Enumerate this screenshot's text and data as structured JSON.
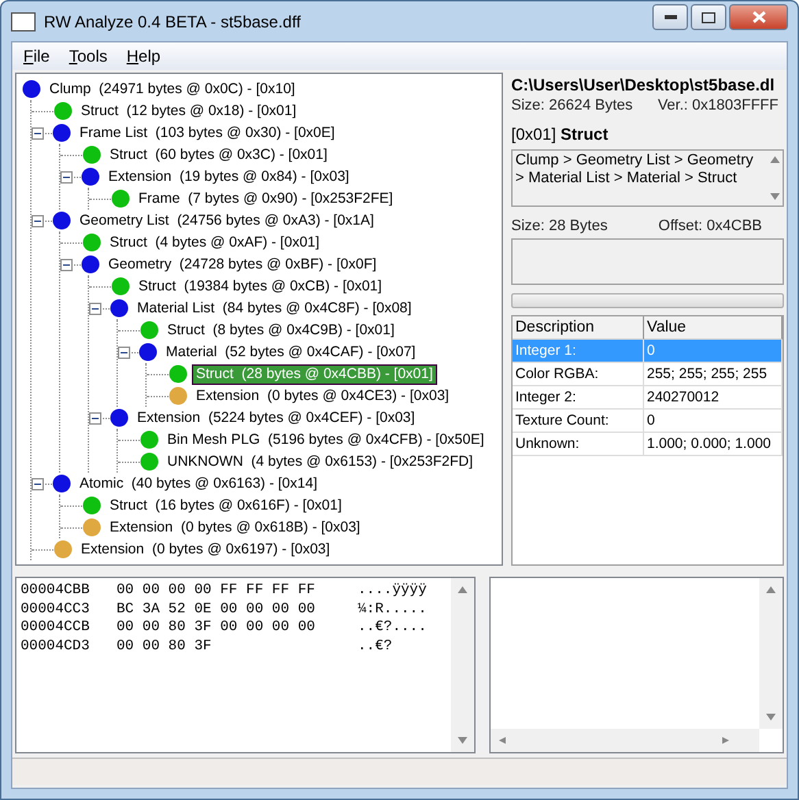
{
  "window": {
    "title": "RW Analyze 0.4 BETA - st5base.dff"
  },
  "menu": [
    {
      "label": "File"
    },
    {
      "label": "Tools"
    },
    {
      "label": "Help"
    }
  ],
  "tree": [
    {
      "label": "Clump  (24971 bytes @ 0x0C) - [0x10]",
      "color": "#1010e0",
      "selected": false,
      "children": [
        {
          "label": "Struct  (12 bytes @ 0x18) - [0x01]",
          "color": "#10c010",
          "selected": false
        },
        {
          "label": "Frame List  (103 bytes @ 0x30) - [0x0E]",
          "color": "#1010e0",
          "selected": false,
          "expanded": true,
          "children": [
            {
              "label": "Struct  (60 bytes @ 0x3C) - [0x01]",
              "color": "#10c010",
              "selected": false
            },
            {
              "label": "Extension  (19 bytes @ 0x84) - [0x03]",
              "color": "#1010e0",
              "selected": false,
              "expanded": true,
              "children": [
                {
                  "label": "Frame  (7 bytes @ 0x90) - [0x253F2FE]",
                  "color": "#10c010",
                  "selected": false
                }
              ]
            }
          ]
        },
        {
          "label": "Geometry List  (24756 bytes @ 0xA3) - [0x1A]",
          "color": "#1010e0",
          "selected": false,
          "expanded": true,
          "children": [
            {
              "label": "Struct  (4 bytes @ 0xAF) - [0x01]",
              "color": "#10c010",
              "selected": false
            },
            {
              "label": "Geometry  (24728 bytes @ 0xBF) - [0x0F]",
              "color": "#1010e0",
              "selected": false,
              "expanded": true,
              "children": [
                {
                  "label": "Struct  (19384 bytes @ 0xCB) - [0x01]",
                  "color": "#10c010",
                  "selected": false
                },
                {
                  "label": "Material List  (84 bytes @ 0x4C8F) - [0x08]",
                  "color": "#1010e0",
                  "selected": false,
                  "expanded": true,
                  "children": [
                    {
                      "label": "Struct  (8 bytes @ 0x4C9B) - [0x01]",
                      "color": "#10c010",
                      "selected": false
                    },
                    {
                      "label": "Material  (52 bytes @ 0x4CAF) - [0x07]",
                      "color": "#1010e0",
                      "selected": false,
                      "expanded": true,
                      "children": [
                        {
                          "label": "Struct  (28 bytes @ 0x4CBB) - [0x01]",
                          "color": "#10c010",
                          "selected": true
                        },
                        {
                          "label": "Extension  (0 bytes @ 0x4CE3) - [0x03]",
                          "color": "#e0a840",
                          "selected": false
                        }
                      ]
                    }
                  ]
                },
                {
                  "label": "Extension  (5224 bytes @ 0x4CEF) - [0x03]",
                  "color": "#1010e0",
                  "selected": false,
                  "expanded": true,
                  "children": [
                    {
                      "label": "Bin Mesh PLG  (5196 bytes @ 0x4CFB) - [0x50E]",
                      "color": "#10c010",
                      "selected": false
                    },
                    {
                      "label": "UNKNOWN  (4 bytes @ 0x6153) - [0x253F2FD]",
                      "color": "#10c010",
                      "selected": false
                    }
                  ]
                }
              ]
            }
          ]
        },
        {
          "label": "Atomic  (40 bytes @ 0x6163) - [0x14]",
          "color": "#1010e0",
          "selected": false,
          "expanded": true,
          "children": [
            {
              "label": "Struct  (16 bytes @ 0x616F) - [0x01]",
              "color": "#10c010",
              "selected": false
            },
            {
              "label": "Extension  (0 bytes @ 0x618B) - [0x03]",
              "color": "#e0a840",
              "selected": false
            }
          ]
        },
        {
          "label": "Extension  (0 bytes @ 0x6197) - [0x03]",
          "color": "#e0a840",
          "selected": false
        }
      ]
    }
  ],
  "file": {
    "path": "C:\\Users\\User\\Desktop\\st5base.dl",
    "size": "Size: 26624 Bytes",
    "version": "Ver.: 0x1803FFFF"
  },
  "section": {
    "heading": "[0x01] **Struct**",
    "breadcrumb": "Clump > Geometry List > Geometry > Material List > Material > Struct",
    "size": "Size: 28 Bytes",
    "offset": "Offset: 0x4CBB"
  },
  "progress": {
    "level": 0
  },
  "table": {
    "columns": [
      "Description",
      "Value"
    ],
    "rows": [
      {
        "cells": [
          "Integer 1:",
          "0"
        ],
        "selected": true
      },
      {
        "cells": [
          "Color RGBA:",
          "255; 255; 255; 255"
        ],
        "selected": false
      },
      {
        "cells": [
          "Integer 2:",
          "240270012"
        ],
        "selected": false
      },
      {
        "cells": [
          "Texture Count:",
          "0"
        ],
        "selected": false
      },
      {
        "cells": [
          "Unknown:",
          "1.000; 0.000; 1.000"
        ],
        "selected": false
      }
    ]
  },
  "hex": [
    {
      "offset": "00004CBB",
      "bytes": "00 00 00 00 FF FF FF FF",
      "ascii": "....ÿÿÿÿ"
    },
    {
      "offset": "00004CC3",
      "bytes": "BC 3A 52 0E 00 00 00 00",
      "ascii": "¼:R....."
    },
    {
      "offset": "00004CCB",
      "bytes": "00 00 80 3F 00 00 00 00",
      "ascii": "..€?...."
    },
    {
      "offset": "00004CD3",
      "bytes": "00 00 80 3F",
      "ascii": "..€?"
    }
  ]
}
